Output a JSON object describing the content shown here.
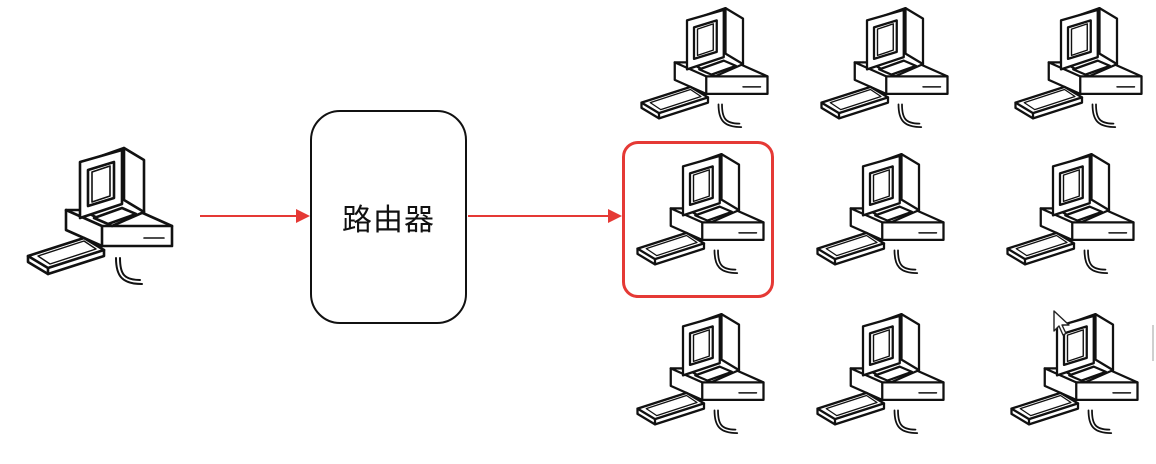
{
  "diagram": {
    "router_label": "路由器",
    "arrow_color": "#e53935",
    "highlight_color": "#e53935",
    "source_computer": {
      "icon": "desktop-computer-icon"
    },
    "target_grid": {
      "rows": 3,
      "columns": 3,
      "icon": "desktop-computer-icon",
      "highlighted_row": 2,
      "highlighted_column": 1
    },
    "connections": [
      {
        "from": "source-computer",
        "to": "router"
      },
      {
        "from": "router",
        "to": "target-computer-r2-c1"
      }
    ]
  }
}
